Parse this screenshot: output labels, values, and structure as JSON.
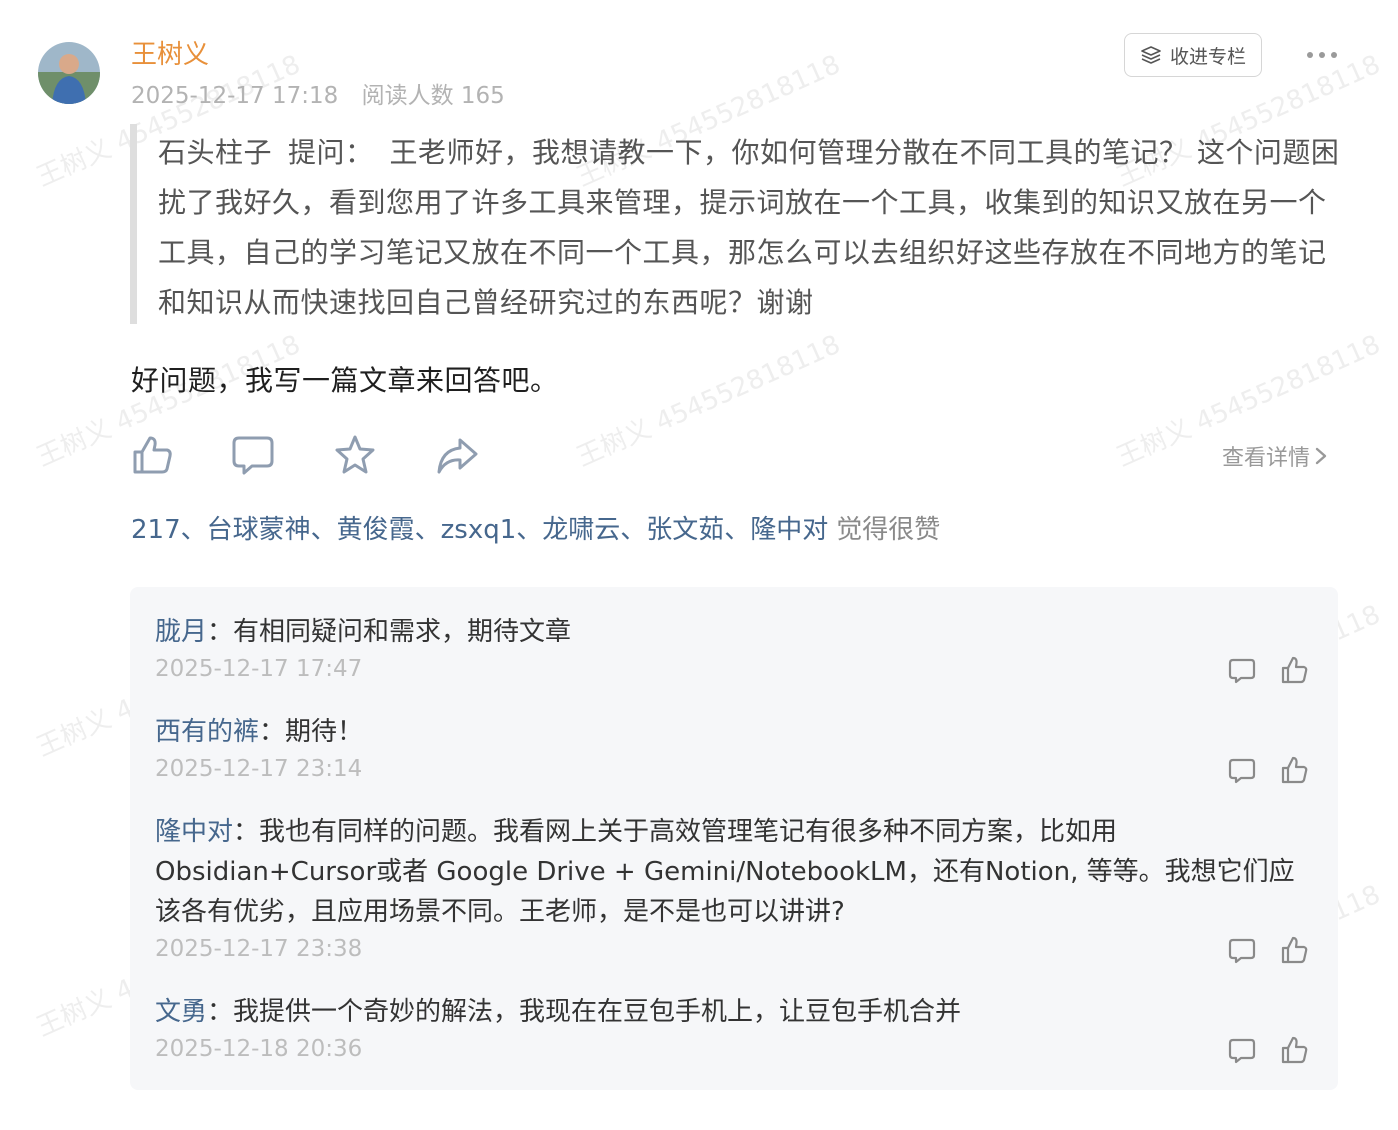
{
  "post": {
    "author": "王树义",
    "date": "2025-12-17 17:18",
    "views": "阅读人数 165",
    "collect_label": "收进专栏",
    "question_asker": "石头柱子",
    "question_label": "提问：",
    "question_body": "王老师好，我想请教一下，你如何管理分散在不同工具的笔记？ 这个问题困扰了我好久，看到您用了许多工具来管理，提示词放在一个工具，收集到的知识又放在另一个工具，自己的学习笔记又放在不同一个工具，那怎么可以去组织好这些存放在不同地方的笔记和知识从而快速找回自己曾经研究过的东西呢？谢谢",
    "answer": "好问题，我写一篇文章来回答吧。",
    "detail_link": "查看详情",
    "likes_names": "217、台球蒙神、黄俊霞、zsxq1、龙啸云、张文茹、隆中对",
    "likes_suffix": "觉得很赞"
  },
  "watermark": "王树义 454552818118",
  "icons": {
    "like": "thumb-up-icon",
    "comment": "comment-icon",
    "favorite": "star-icon",
    "share": "share-icon",
    "more": "more-dots-icon",
    "collect": "layers-icon",
    "chevron": "chevron-right-icon"
  },
  "comments": [
    {
      "name": "胧月",
      "sep": "：",
      "text": "有相同疑问和需求，期待文章",
      "date": "2025-12-17 17:47"
    },
    {
      "name": "西有的裤",
      "sep": "：",
      "text": "期待！",
      "date": "2025-12-17 23:14"
    },
    {
      "name": "隆中对",
      "sep": "：",
      "text": "我也有同样的问题。我看网上关于高效管理笔记有很多种不同方案，比如用 Obsidian+Cursor或者 Google Drive + Gemini/NotebookLM，还有Notion, 等等。我想它们应该各有优劣，且应用场景不同。王老师，是不是也可以讲讲?",
      "date": "2025-12-17 23:38"
    },
    {
      "name": "文勇",
      "sep": "：",
      "text": "我提供一个奇妙的解法，我现在在豆包手机上，让豆包手机合并",
      "date": "2025-12-18 20:36"
    }
  ],
  "colors": {
    "author": "#e8903a",
    "link_blue": "#46678d",
    "muted": "#b3b3b3",
    "panel_bg": "#f6f7f9"
  }
}
